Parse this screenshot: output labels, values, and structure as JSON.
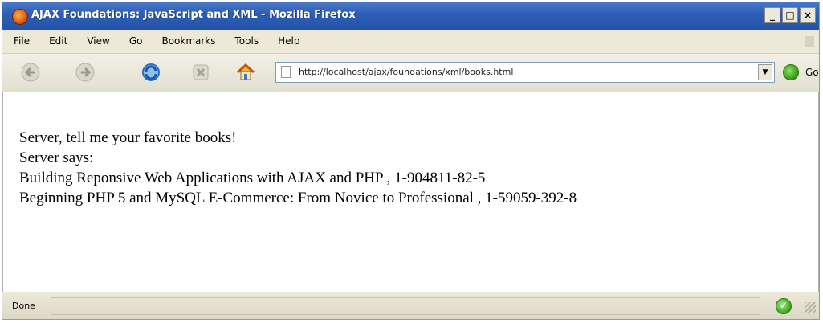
{
  "window": {
    "title": "AJAX Foundations: JavaScript and XML - Mozilla Firefox",
    "minimize_label": "_",
    "maximize_label": "□",
    "close_label": "×"
  },
  "menu": {
    "items": [
      {
        "label": "File"
      },
      {
        "label": "Edit"
      },
      {
        "label": "View"
      },
      {
        "label": "Go"
      },
      {
        "label": "Bookmarks"
      },
      {
        "label": "Tools"
      },
      {
        "label": "Help"
      }
    ]
  },
  "navbar": {
    "url": "http://localhost/ajax/foundations/xml/books.html",
    "go_label": "Go",
    "dropdown_glyph": "▼"
  },
  "page": {
    "lines": [
      "Server, tell me your favorite books!",
      "Server says:",
      "Building Reponsive Web Applications with AJAX and PHP , 1-904811-82-5",
      "Beginning PHP 5 and MySQL E-Commerce: From Novice to Professional , 1-59059-392-8"
    ]
  },
  "status": {
    "text": "Done",
    "ok_glyph": "✓"
  },
  "icons": {
    "app": "firefox-icon",
    "back": "back-arrow-icon",
    "forward": "forward-arrow-icon",
    "reload": "reload-icon",
    "stop": "stop-icon",
    "home": "home-icon",
    "go": "go-arrow-icon",
    "status_ok": "connection-ok-icon"
  },
  "colors": {
    "titlebar": "#2f5fb4",
    "chrome": "#ece9d8",
    "content_bg": "#ffffff"
  }
}
